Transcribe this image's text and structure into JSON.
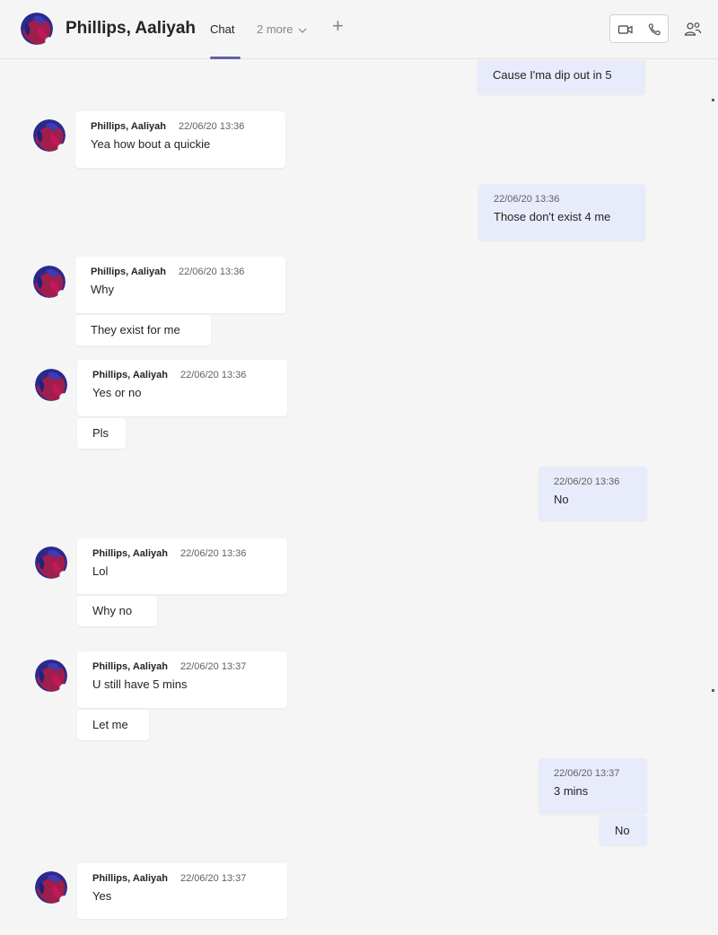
{
  "header": {
    "title": "Phillips, Aaliyah",
    "tab_chat": "Chat",
    "more": "2 more",
    "add_tab": "+"
  },
  "messages": {
    "m0": {
      "text": "Cause I'ma dip out in 5"
    },
    "m1": {
      "name": "Phillips, Aaliyah",
      "time": "22/06/20 13:36",
      "text": "Yea how bout a quickie"
    },
    "m2": {
      "time": "22/06/20 13:36",
      "text": "Those don't exist 4 me"
    },
    "m3": {
      "name": "Phillips, Aaliyah",
      "time": "22/06/20 13:36",
      "text": "Why"
    },
    "m4": {
      "text": "They exist for me"
    },
    "m5": {
      "name": "Phillips, Aaliyah",
      "time": "22/06/20 13:36",
      "text": "Yes or no"
    },
    "m6": {
      "text": "Pls"
    },
    "m7": {
      "time": "22/06/20 13:36",
      "text": "No"
    },
    "m8": {
      "name": "Phillips, Aaliyah",
      "time": "22/06/20 13:36",
      "text": "Lol"
    },
    "m9": {
      "text": "Why no"
    },
    "m10": {
      "name": "Phillips, Aaliyah",
      "time": "22/06/20 13:37",
      "text": "U still have 5 mins"
    },
    "m11": {
      "text": "Let me"
    },
    "m12": {
      "time": "22/06/20 13:37",
      "text": "3 mins"
    },
    "m13": {
      "text": "No"
    },
    "m14": {
      "name": "Phillips, Aaliyah",
      "time": "22/06/20 13:37",
      "text": "Yes"
    }
  },
  "icons": {
    "video": "video-call-icon",
    "audio": "audio-call-icon",
    "people": "people-icon",
    "chevron": "chevron-down-icon"
  },
  "colors": {
    "accent": "#6264a7",
    "my_bubble": "#e8ebfa",
    "their_bubble": "#ffffff",
    "background": "#f5f5f5"
  }
}
